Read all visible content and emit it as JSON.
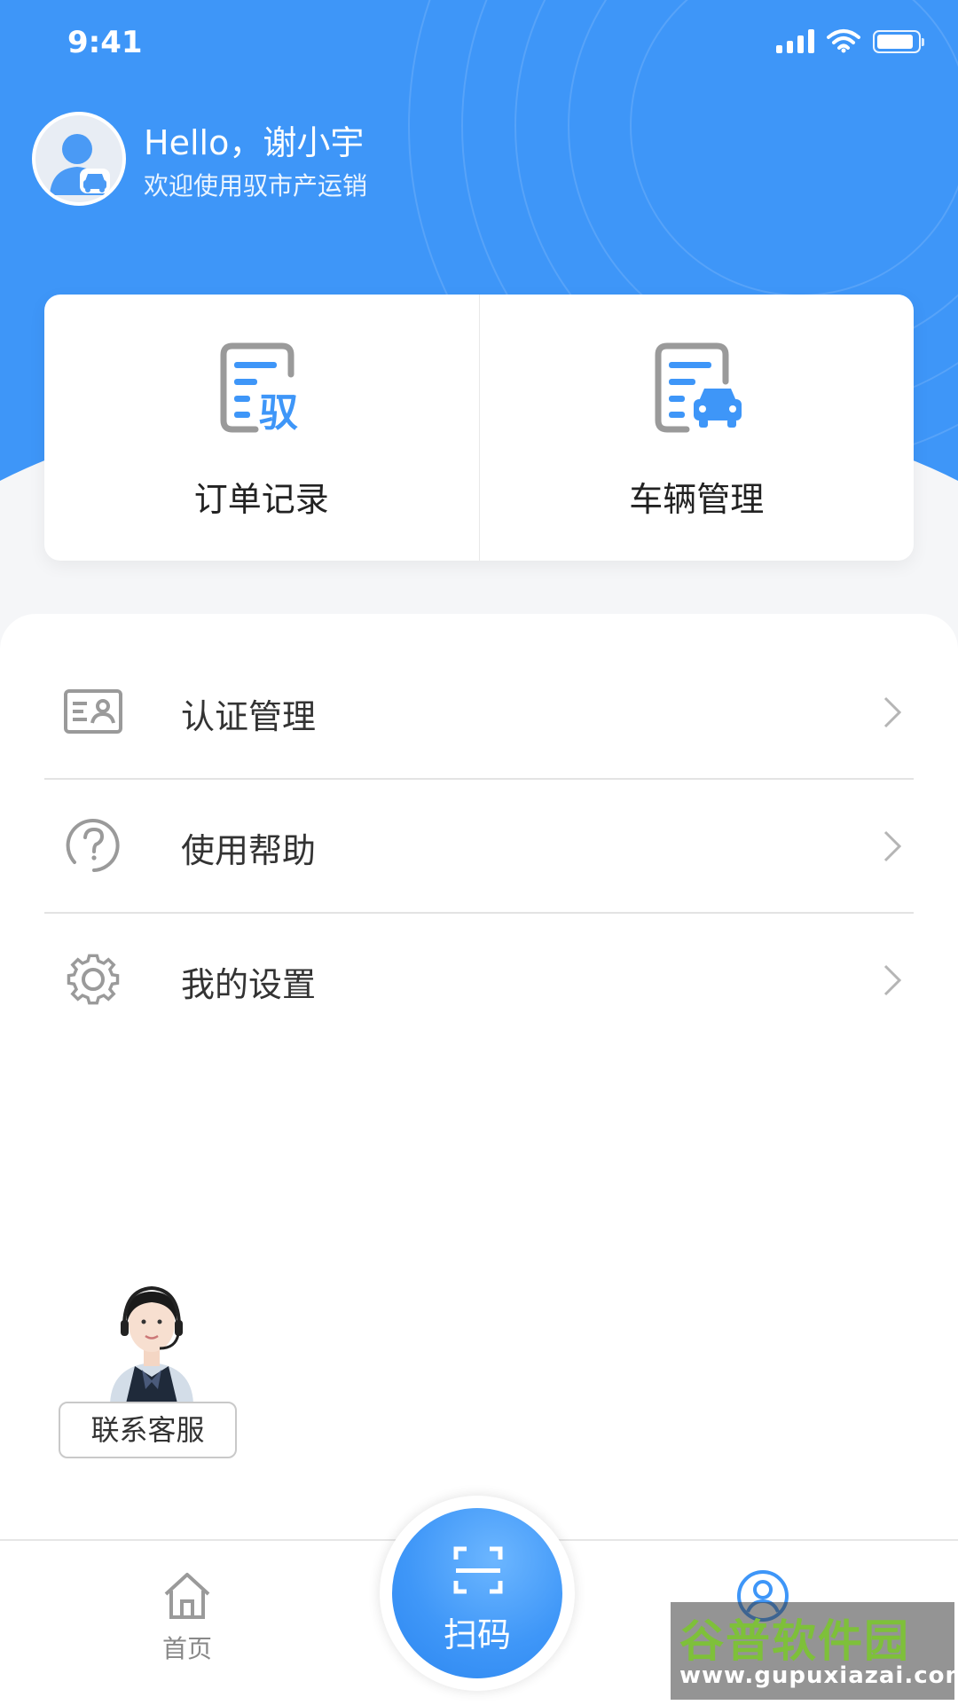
{
  "status_bar": {
    "time": "9:41"
  },
  "profile": {
    "greeting": "Hello，谢小宇",
    "subtitle": "欢迎使用驭市产运销"
  },
  "quick_actions": [
    {
      "label": "订单记录",
      "icon": "order-record-icon"
    },
    {
      "label": "车辆管理",
      "icon": "vehicle-management-icon"
    }
  ],
  "menu": [
    {
      "label": "认证管理",
      "icon": "id-card-icon"
    },
    {
      "label": "使用帮助",
      "icon": "help-icon"
    },
    {
      "label": "我的设置",
      "icon": "gear-icon"
    }
  ],
  "customer_service": {
    "label": "联系客服"
  },
  "bottom_nav": {
    "home_label": "首页",
    "scan_label": "扫码",
    "profile_icon": "user-icon"
  },
  "watermark": {
    "title": "谷普软件园",
    "url": "www.gupuxiazai.com"
  },
  "colors": {
    "primary": "#3e96f8",
    "text": "#333333"
  }
}
